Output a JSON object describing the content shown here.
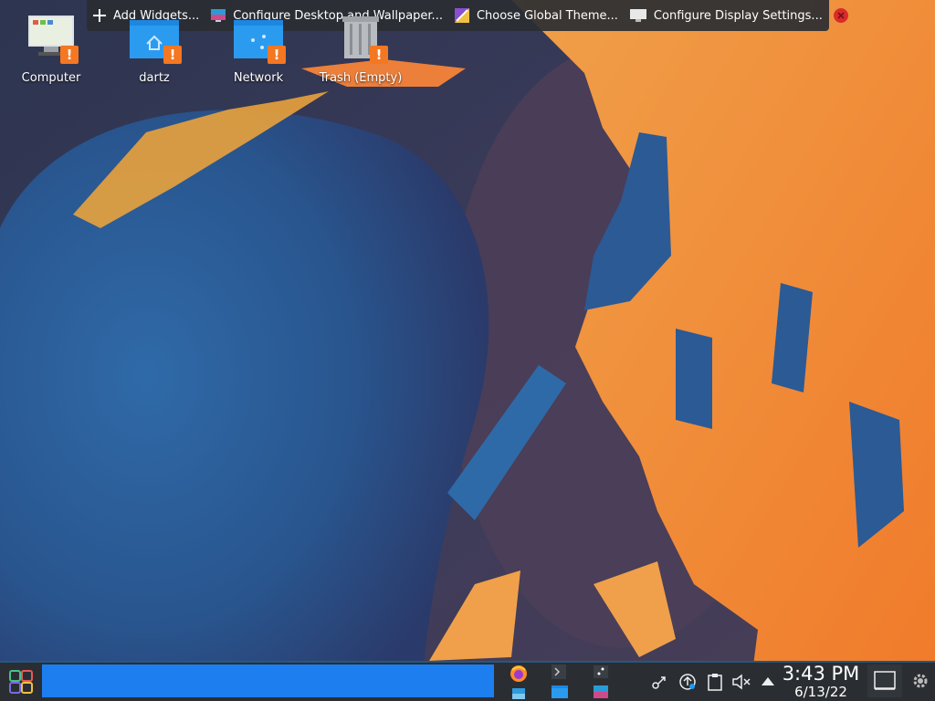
{
  "toolbar": {
    "add_widgets": "Add Widgets...",
    "configure_desktop": "Configure Desktop and Wallpaper...",
    "global_theme": "Choose Global Theme...",
    "display_settings": "Configure Display Settings..."
  },
  "desktop_icons": [
    {
      "label": "Computer",
      "icon": "computer-icon",
      "warning": "!"
    },
    {
      "label": "dartz",
      "icon": "home-folder-icon",
      "warning": "!"
    },
    {
      "label": "Network",
      "icon": "network-folder-icon",
      "warning": "!"
    },
    {
      "label": "Trash (Empty)",
      "icon": "trash-icon",
      "warning": "!"
    }
  ],
  "panel": {
    "clock_time": "3:43 PM",
    "clock_date": "6/13/22",
    "tasks": [
      "firefox-icon",
      "terminal-icon",
      "file-manager-icon",
      "screenshot-icon",
      "image-viewer-icon"
    ],
    "tray_icons": [
      "kde-connect-icon",
      "updates-icon",
      "clipboard-icon",
      "volume-muted-icon",
      "expand-tray-icon"
    ]
  },
  "colors": {
    "panel": "#2a2e32",
    "active_task": "#1d7ef0",
    "warning": "#f47722",
    "accent": "#1d99f3"
  }
}
